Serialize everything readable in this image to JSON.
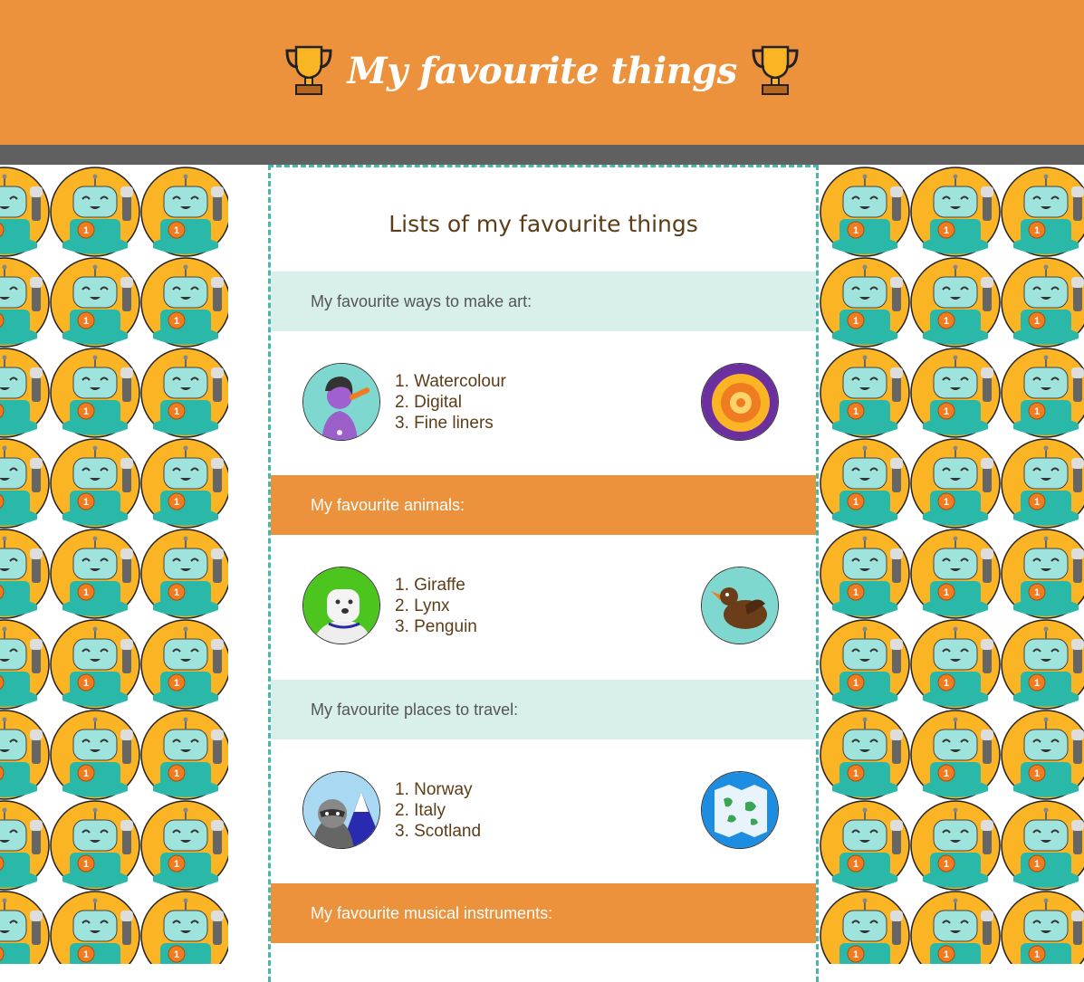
{
  "header": {
    "title": "My favourite things",
    "icon": "trophy-icon"
  },
  "main": {
    "title": "Lists of my favourite things"
  },
  "sections": [
    {
      "heading": "My favourite ways to make art:",
      "items": [
        "1. Watercolour",
        "2. Digital",
        "3. Fine liners"
      ],
      "left_icon": "artist-avatar-icon",
      "right_icon": "mandala-icon"
    },
    {
      "heading": "My favourite animals:",
      "items": [
        "1. Giraffe",
        "2. Lynx",
        "3. Penguin"
      ],
      "left_icon": "dog-avatar-icon",
      "right_icon": "bird-icon"
    },
    {
      "heading": "My favourite places to travel:",
      "items": [
        "1. Norway",
        "2. Italy",
        "3. Scotland"
      ],
      "left_icon": "raccoon-mountain-icon",
      "right_icon": "map-icon"
    },
    {
      "heading": "My favourite musical instruments:"
    }
  ],
  "colors": {
    "header": "#ec913c",
    "strip": "#606060",
    "light_band": "#d8efec",
    "accent_border": "#49b7a8",
    "text_brown": "#5c3d17"
  }
}
